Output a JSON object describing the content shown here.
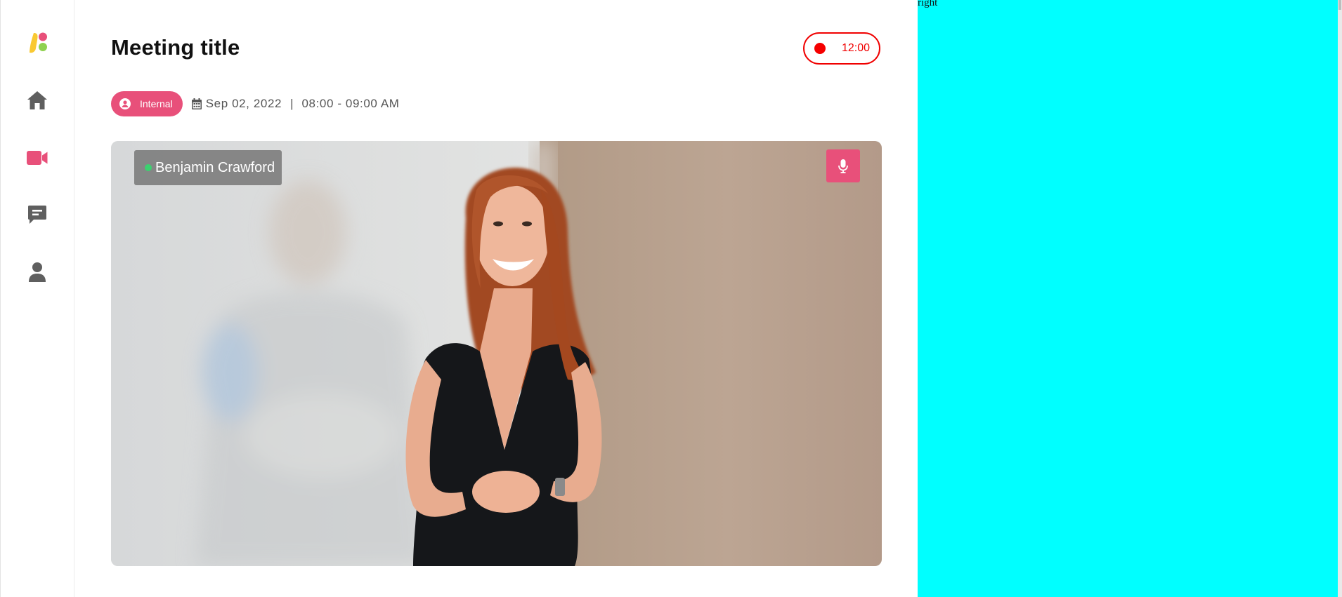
{
  "sidebar": {
    "logo_icon": "app-logo-icon",
    "items": [
      {
        "icon": "home-icon",
        "active": false
      },
      {
        "icon": "video-camera-icon",
        "active": true
      },
      {
        "icon": "chat-icon",
        "active": false
      },
      {
        "icon": "user-icon",
        "active": false
      }
    ]
  },
  "header": {
    "title": "Meeting title",
    "recording": {
      "icon": "record-dot-icon",
      "time": "12:00"
    }
  },
  "meeting": {
    "badge_label": "Internal",
    "badge_icon": "user-circle-icon",
    "calendar_icon": "calendar-icon",
    "date": "Sep 02, 2022",
    "separator": "|",
    "time_range": "08:00 - 09:00 AM"
  },
  "video": {
    "participant_name": "Benjamin Crawford",
    "status": "online",
    "mic_icon": "microphone-icon"
  },
  "right_panel": {
    "label": "right"
  },
  "colors": {
    "accent": "#e8507a",
    "recording": "#f00000",
    "online": "#3bd16f",
    "right_panel": "#00ffff",
    "icon_gray": "#5f5f5f"
  }
}
